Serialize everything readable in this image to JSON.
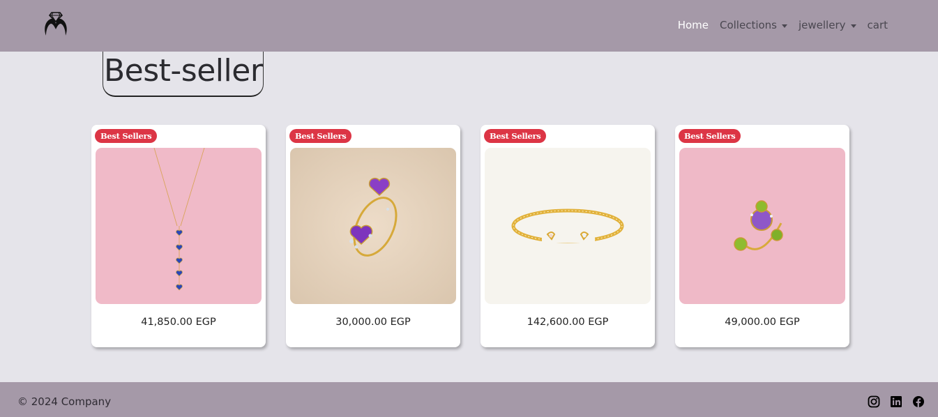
{
  "nav": {
    "logo": "brand-logo-ring-icon",
    "links": [
      {
        "label": "Home",
        "active": true
      },
      {
        "label": "Collections",
        "dropdown": true
      },
      {
        "label": "jewellery",
        "dropdown": true
      },
      {
        "label": "cart"
      }
    ]
  },
  "page": {
    "title": "Best-seller"
  },
  "products": [
    {
      "badge": "Best Sellers",
      "price": "41,850.00 EGP",
      "image": "sapphire-heart-drop-necklace",
      "bg": "#f0bac8"
    },
    {
      "badge": "Best Sellers",
      "price": "30,000.00 EGP",
      "image": "amethyst-heart-open-ring",
      "bg": "#e6d5c1"
    },
    {
      "badge": "Best Sellers",
      "price": "142,600.00 EGP",
      "image": "gold-diamond-cuff-bracelet",
      "bg": "#f7f5ef"
    },
    {
      "badge": "Best Sellers",
      "price": "49,000.00 EGP",
      "image": "amethyst-peridot-flower-ring",
      "bg": "#efb9c7"
    }
  ],
  "footer": {
    "copyright": "© 2024 Company",
    "social": [
      "instagram-icon",
      "linkedin-icon",
      "facebook-icon"
    ]
  },
  "colors": {
    "navbar": "#a599a8",
    "page_bg": "#e5e4ea",
    "badge": "#dc3545"
  }
}
